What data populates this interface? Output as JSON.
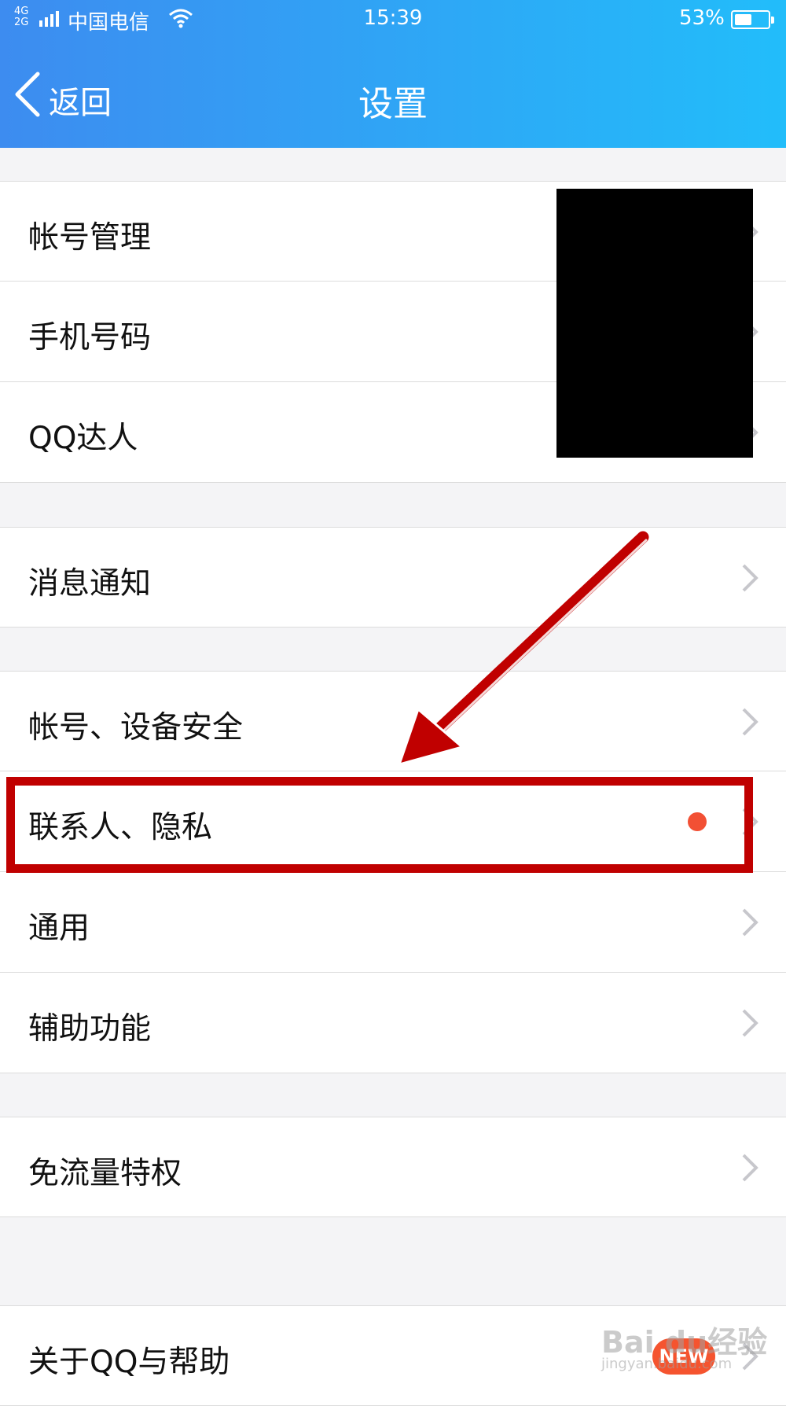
{
  "status_bar": {
    "network": "4G\n2G",
    "carrier": "中国电信",
    "time": "15:39",
    "battery_percent": "53%",
    "battery_level": 0.53
  },
  "nav": {
    "back_label": "返回",
    "title": "设置"
  },
  "settings": {
    "account_management": "帐号管理",
    "phone_number": "手机号码",
    "qq_expert": "QQ达人",
    "notifications": "消息通知",
    "account_device_security": "帐号、设备安全",
    "contacts_privacy": "联系人、隐私",
    "general": "通用",
    "accessibility": "辅助功能",
    "free_data": "免流量特权",
    "about_help": "关于QQ与帮助"
  },
  "badges": {
    "new_label": "NEW"
  },
  "watermark": {
    "text": "Bai du经验",
    "url": "jingyan.baidu.com"
  },
  "colors": {
    "header_start": "#3d8cf0",
    "header_end": "#22bdfa",
    "highlight": "#c00000",
    "dot": "#f25034"
  }
}
